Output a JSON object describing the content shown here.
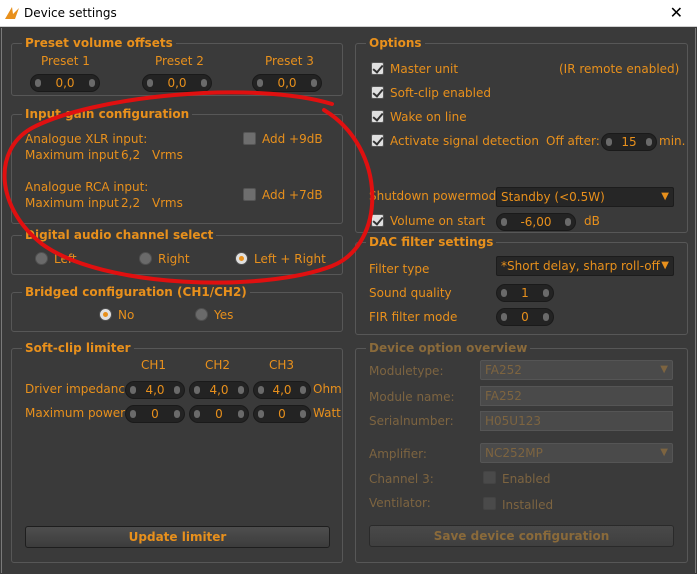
{
  "window": {
    "title": "Device settings",
    "close_glyph": "✕",
    "app_icon": "wing-logo-icon"
  },
  "preset_volume_offsets": {
    "title": "Preset volume offsets",
    "presets": [
      {
        "label": "Preset 1",
        "value": "0,0"
      },
      {
        "label": "Preset 2",
        "value": "0,0"
      },
      {
        "label": "Preset 3",
        "value": "0,0"
      }
    ]
  },
  "input_gain": {
    "title": "Input gain configuration",
    "xlr": {
      "label": "Analogue XLR input:",
      "max_label": "Maximum input",
      "max_value": "6,2",
      "unit": "Vrms",
      "add_label": "Add +9dB",
      "add_checked": false
    },
    "rca": {
      "label": "Analogue RCA input:",
      "max_label": "Maximum input",
      "max_value": "2,2",
      "unit": "Vrms",
      "add_label": "Add +7dB",
      "add_checked": false
    }
  },
  "digital_channel": {
    "title": "Digital audio channel select",
    "options": [
      "Left",
      "Right",
      "Left + Right"
    ],
    "selected": "Left + Right"
  },
  "bridged": {
    "title": "Bridged configuration (CH1/CH2)",
    "options": [
      "No",
      "Yes"
    ],
    "selected": "No"
  },
  "soft_clip": {
    "title": "Soft-clip limiter",
    "channels": [
      "CH1",
      "CH2",
      "CH3"
    ],
    "impedance_label": "Driver impedance",
    "impedance_values": [
      "4,0",
      "4,0",
      "4,0"
    ],
    "impedance_unit": "Ohm",
    "power_label": "Maximum power",
    "power_values": [
      "0",
      "0",
      "0"
    ],
    "power_unit": "Watt",
    "update_button": "Update limiter"
  },
  "options": {
    "title": "Options",
    "master_unit": {
      "label": "Master unit",
      "checked": true,
      "note": "(IR remote enabled)"
    },
    "soft_clip_enabled": {
      "label": "Soft-clip enabled",
      "checked": true
    },
    "wake_on_line": {
      "label": "Wake on line",
      "checked": true
    },
    "signal_detection": {
      "label": "Activate signal detection",
      "checked": true,
      "off_after_label": "Off after:",
      "off_after_value": "15",
      "off_after_unit": "min."
    },
    "shutdown_label": "Shutdown powermode:",
    "shutdown_value": "Standby (<0.5W)",
    "volume_on_start": {
      "label": "Volume on start",
      "checked": true,
      "value": "-6,00",
      "unit": "dB"
    }
  },
  "dac_filter": {
    "title": "DAC filter settings",
    "filter_type_label": "Filter type",
    "filter_type_value": "*Short delay, sharp roll-off",
    "sound_quality_label": "Sound quality",
    "sound_quality_value": "1",
    "fir_label": "FIR filter mode",
    "fir_value": "0"
  },
  "device_overview": {
    "title": "Device option overview",
    "moduletype_label": "Moduletype:",
    "moduletype_value": "FA252",
    "module_name_label": "Module name:",
    "module_name_value": "FA252",
    "serial_label": "Serialnumber:",
    "serial_value": "H05U123",
    "amplifier_label": "Amplifier:",
    "amplifier_value": "NC252MP",
    "channel3_label": "Channel 3:",
    "channel3_option": "Enabled",
    "ventilator_label": "Ventilator:",
    "ventilator_option": "Installed",
    "save_button": "Save device configuration"
  },
  "colors": {
    "accent": "#e8901c",
    "background": "#3a3a3a",
    "annotation": "#e01010"
  }
}
